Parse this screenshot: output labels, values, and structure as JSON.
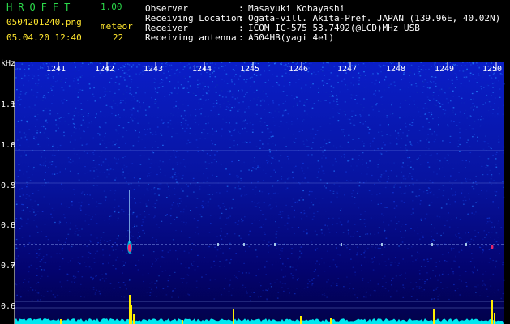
{
  "app": {
    "title": "HROFFT",
    "version": "1.00"
  },
  "file": {
    "name": "0504201240.png",
    "datetime": "05.04.20 12:40"
  },
  "meteor": {
    "label": "meteor",
    "count": "22"
  },
  "station": {
    "fields": [
      {
        "label": "Observer",
        "value": "Masayuki Kobayashi"
      },
      {
        "label": "Receiving Location",
        "value": "Ogata-vill. Akita-Pref. JAPAN (139.96E, 40.02N)"
      },
      {
        "label": "Receiver",
        "value": "ICOM IC-575 53.7492(@LCD)MHz USB"
      },
      {
        "label": "Receiving antenna",
        "value": "A504HB(yagi 4el)"
      }
    ]
  },
  "spectrogram": {
    "y_unit": "kHz",
    "y_ticks": [
      "1.1",
      "1.0",
      "0.9",
      "0.8",
      "0.7",
      "0.6"
    ],
    "x_ticks": [
      "1241",
      "1242",
      "1243",
      "1244",
      "1245",
      "1246",
      "1247",
      "1248",
      "1249",
      "1250"
    ],
    "colors": {
      "background": "#03036e",
      "noise_bright": "#1f6cf0",
      "baseline_trace": "#00e8f0",
      "event_marker": "#ffee00",
      "echo_head": "#ff2a6a"
    }
  }
}
